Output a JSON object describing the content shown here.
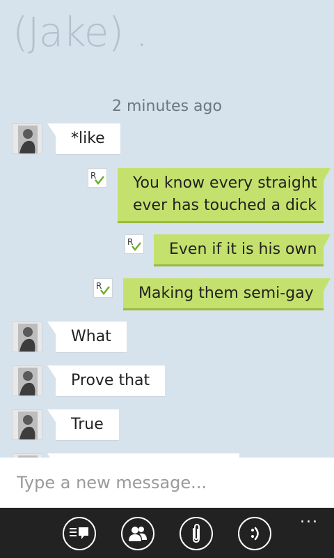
{
  "contact": {
    "title": "(Jake) ."
  },
  "conversation": {
    "timestamp": "2 minutes ago",
    "messages": [
      {
        "direction": "incoming",
        "text": "*like"
      },
      {
        "direction": "outgoing",
        "line1": "You know every straight",
        "line2": "ever has touched a dick"
      },
      {
        "direction": "outgoing",
        "text": "Even if it is his own"
      },
      {
        "direction": "outgoing",
        "text": "Making them semi-gay"
      },
      {
        "direction": "incoming",
        "text": "What"
      },
      {
        "direction": "incoming",
        "text": "Prove that"
      },
      {
        "direction": "incoming",
        "text": "True"
      }
    ]
  },
  "composer": {
    "placeholder": "Type a new message..."
  },
  "appbar": {
    "buttons": [
      "send-icon",
      "contacts-icon",
      "attach-icon",
      "emoji-icon"
    ],
    "more": "..."
  },
  "colors": {
    "background": "#d6e2ec",
    "incoming_bubble": "#ffffff",
    "outgoing_bubble": "#c5e16d",
    "appbar": "#222222"
  }
}
